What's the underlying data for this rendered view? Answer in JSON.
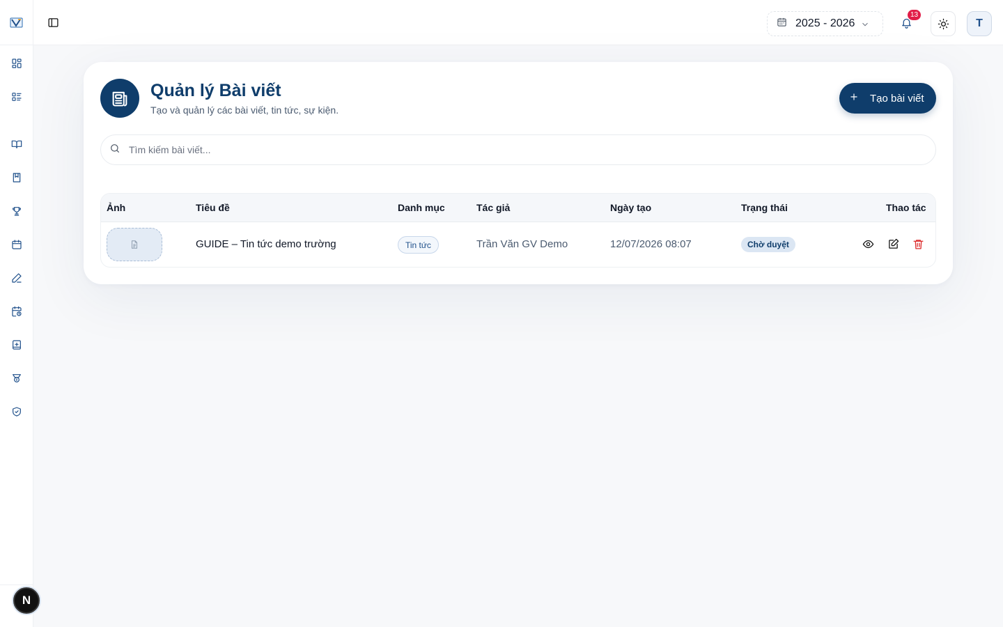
{
  "sidebar": {
    "icons": [
      "dashboard-icon",
      "list-icon",
      "book-open-icon",
      "notebook-icon",
      "trophy-icon",
      "calendar-icon",
      "pen-icon",
      "calendar-clock-icon",
      "book-plus-icon",
      "award-icon",
      "shield-check-icon"
    ],
    "user_badge": "N"
  },
  "header": {
    "school_year": "2025 - 2026",
    "notification_count": "13",
    "avatar_initial": "T"
  },
  "page": {
    "title": "Quản lý Bài viết",
    "subtitle": "Tạo và quản lý các bài viết, tin tức, sự kiện.",
    "create_button": "Tạo bài viết",
    "search_placeholder": "Tìm kiếm bài viết..."
  },
  "table": {
    "headers": {
      "image": "Ảnh",
      "title": "Tiêu đề",
      "category": "Danh mục",
      "author": "Tác giả",
      "created": "Ngày tạo",
      "status": "Trạng thái",
      "actions": "Thao tác"
    },
    "rows": [
      {
        "title": "GUIDE – Tin tức demo trường",
        "category": "Tin tức",
        "author": "Trần Văn GV Demo",
        "created": "12/07/2026 08:07",
        "status": "Chờ duyệt"
      }
    ]
  },
  "colors": {
    "primary": "#0f3d6b",
    "accent": "#1e4f8a",
    "danger": "#dc2626",
    "notification": "#e11d48"
  }
}
